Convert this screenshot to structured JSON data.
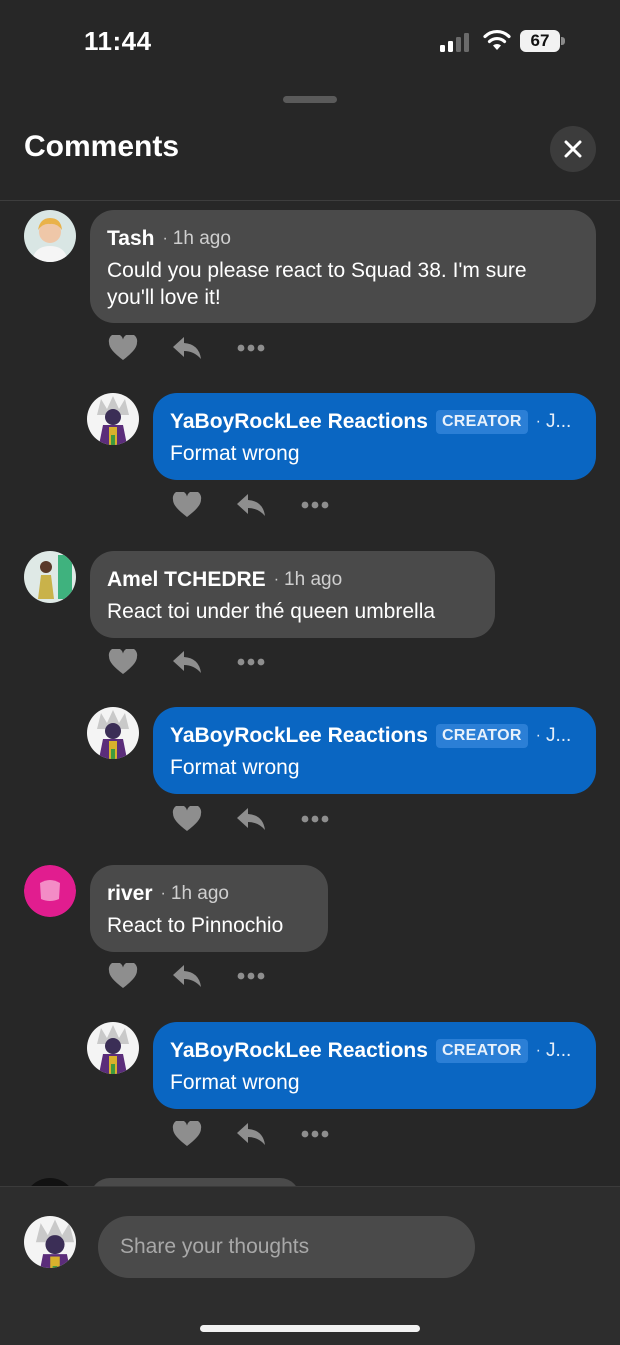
{
  "status": {
    "time": "11:44",
    "battery": "67"
  },
  "header": {
    "title": "Comments"
  },
  "comments": [
    {
      "author": "Tash",
      "ago": "1h ago",
      "text": "Could you please react to Squad 38. I'm sure you'll love it!",
      "reply": {
        "author": "YaBoyRockLee Reactions",
        "badge": "CREATOR",
        "ago": "J...",
        "text": "Format wrong"
      }
    },
    {
      "author": "Amel TCHEDRE",
      "ago": "1h ago",
      "text": "React toi under thé queen umbrella",
      "reply": {
        "author": "YaBoyRockLee Reactions",
        "badge": "CREATOR",
        "ago": "J...",
        "text": "Format wrong"
      }
    },
    {
      "author": "river",
      "ago": "1h ago",
      "text": "React to Pinnochio",
      "reply": {
        "author": "YaBoyRockLee Reactions",
        "badge": "CREATOR",
        "ago": "J...",
        "text": "Format wrong"
      }
    }
  ],
  "composer": {
    "placeholder": "Share your thoughts"
  },
  "colors": {
    "background": "#272727",
    "bubble": "#4a4a4a",
    "creator_bubble": "#0a66c2",
    "river_avatar": "#e11d8f"
  },
  "icons": [
    "heart-icon",
    "reply-icon",
    "more-icon",
    "close-icon",
    "signal-icon",
    "wifi-icon",
    "battery-icon"
  ]
}
